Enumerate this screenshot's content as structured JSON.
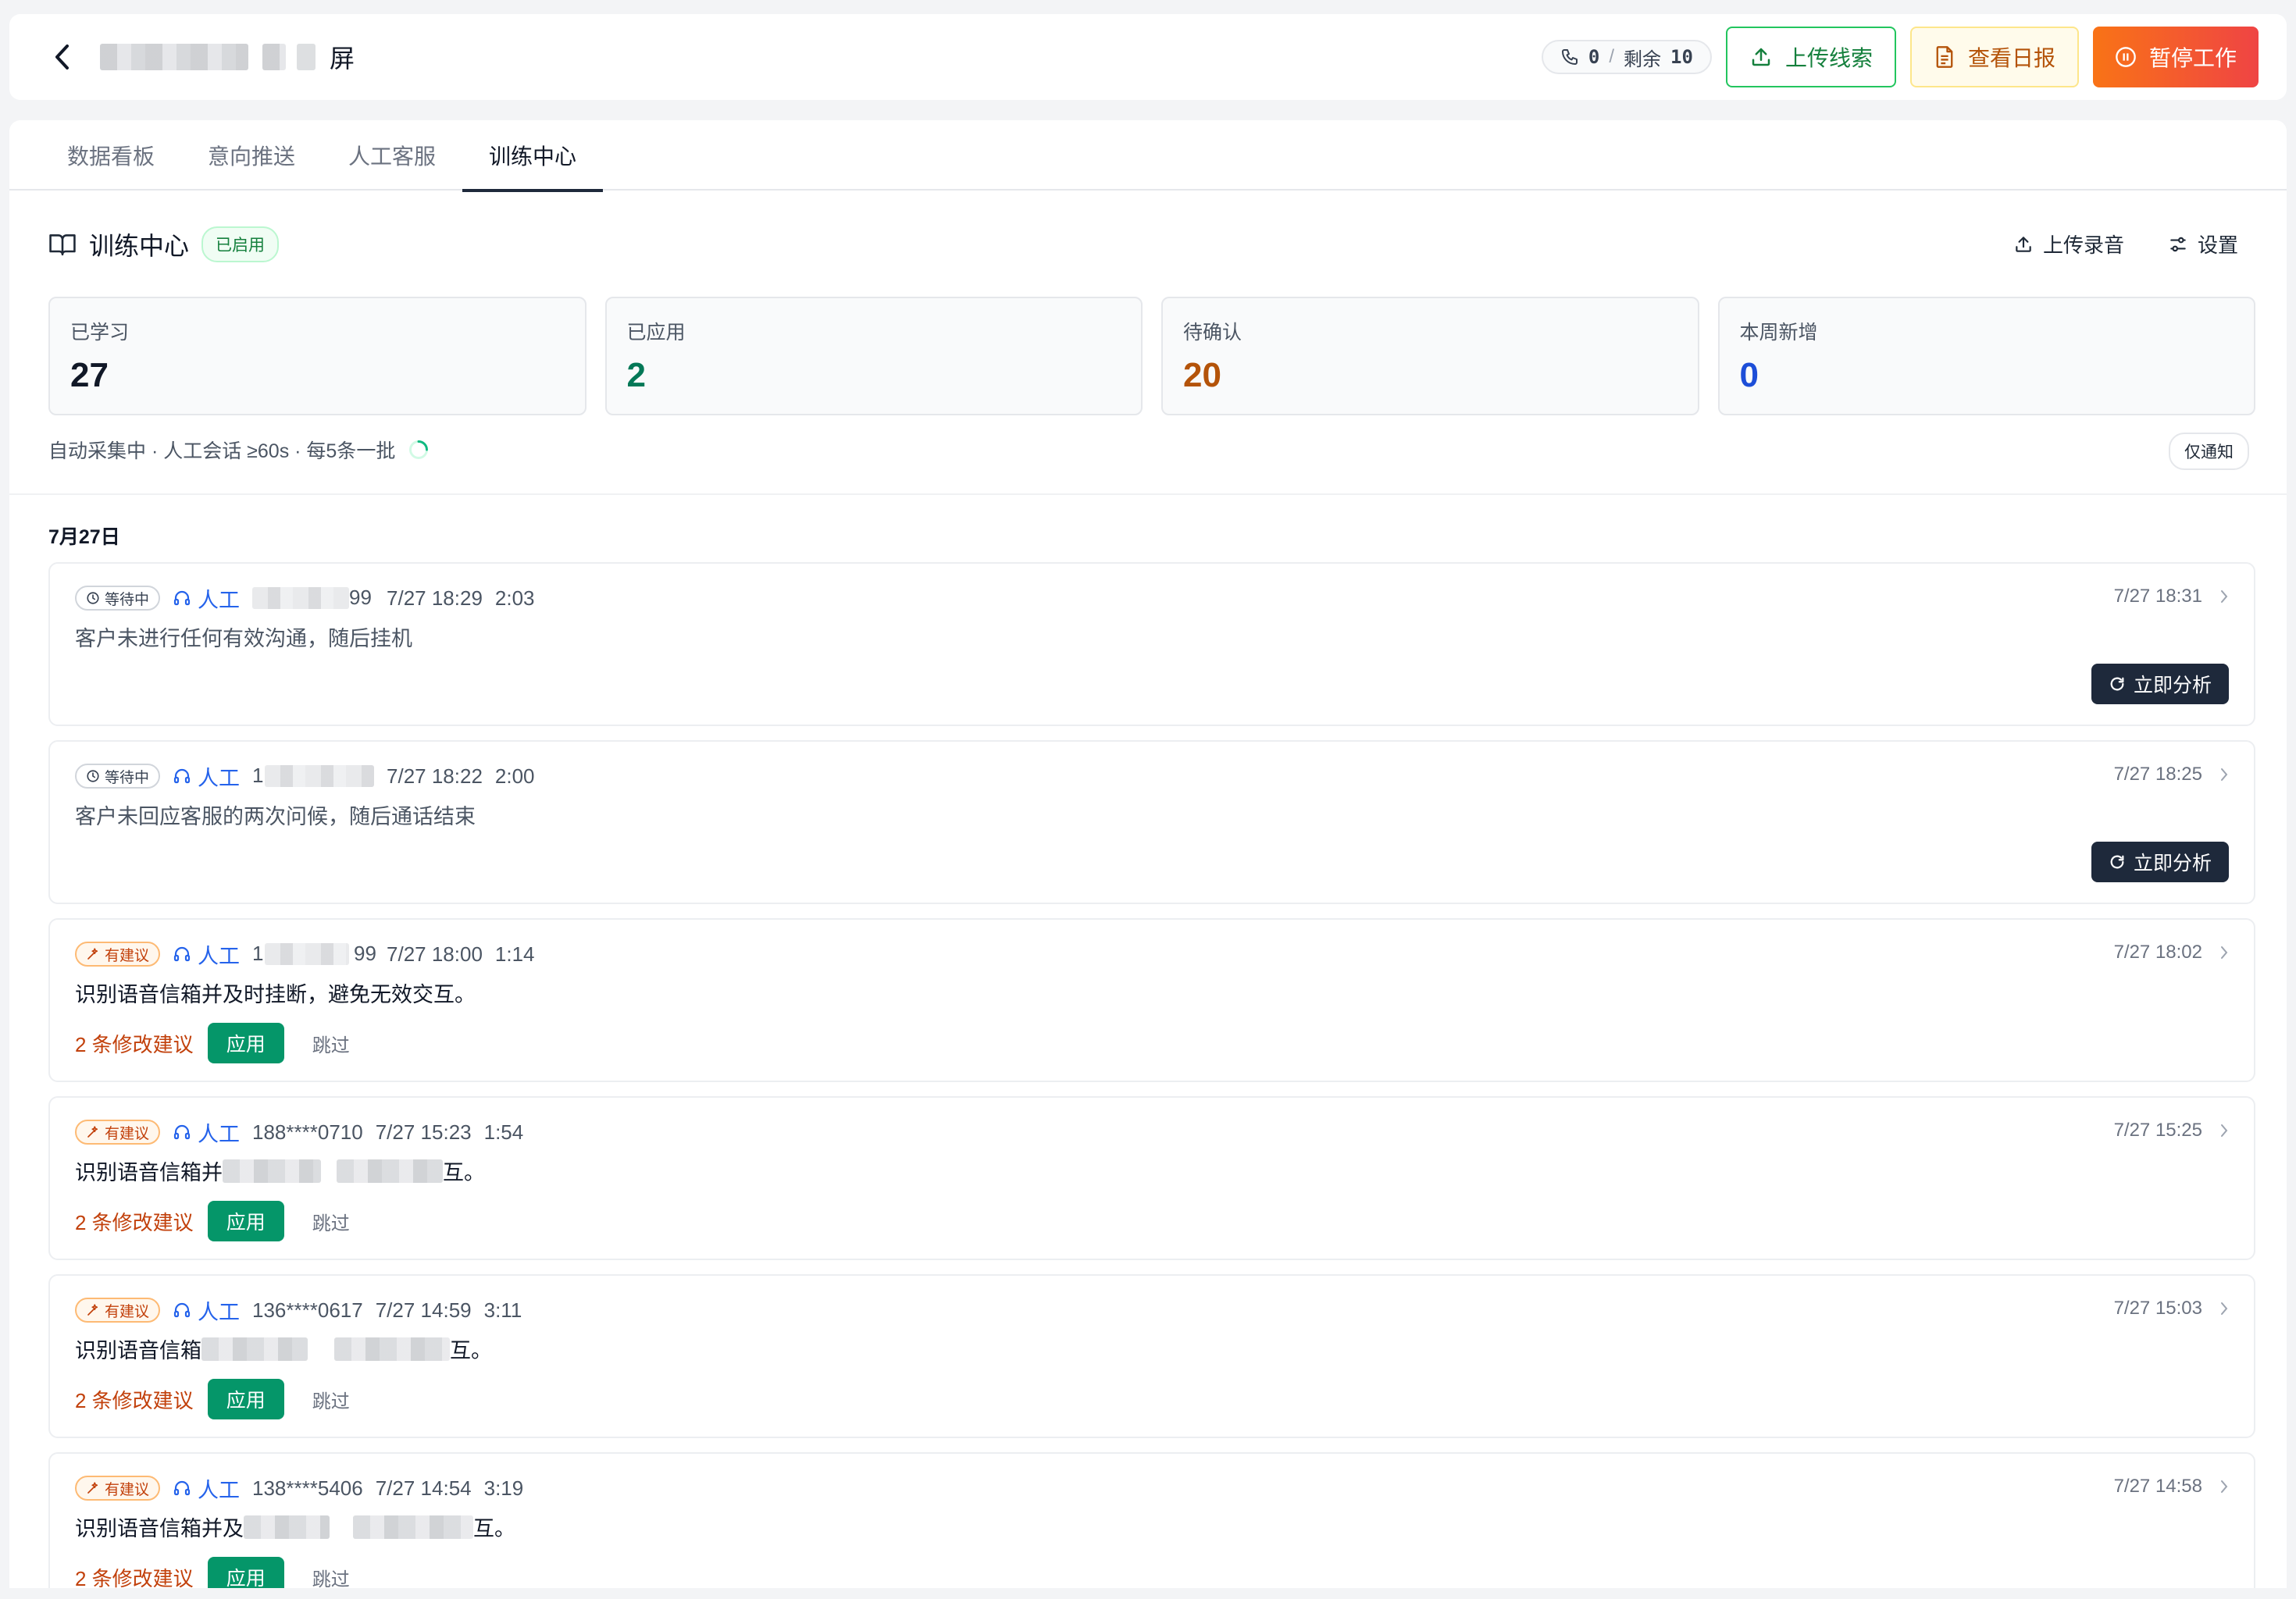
{
  "header": {
    "title_suffix": "屏",
    "calls": "0",
    "separator": "/",
    "remaining_label": "剩余",
    "remaining_count": "10",
    "upload_leads_label": "上传线索",
    "daily_report_label": "查看日报",
    "pause_label": "暂停工作"
  },
  "tabs": [
    {
      "label": "数据看板"
    },
    {
      "label": "意向推送"
    },
    {
      "label": "人工客服"
    },
    {
      "label": "训练中心"
    }
  ],
  "training": {
    "title": "训练中心",
    "status_badge": "已启用",
    "upload_recording_label": "上传录音",
    "settings_label": "设置",
    "stats": [
      {
        "label": "已学习",
        "value": "27",
        "color": "#111827"
      },
      {
        "label": "已应用",
        "value": "2",
        "color": "#047857"
      },
      {
        "label": "待确认",
        "value": "20",
        "color": "#b45309"
      },
      {
        "label": "本周新增",
        "value": "0",
        "color": "#1d4ed8"
      }
    ],
    "collect_status": "自动采集中 · 人工会话 ≥60s · 每5条一批",
    "notify_mode": "仅通知",
    "date_group": "7月27日"
  },
  "records": [
    {
      "status": "等待中",
      "source": "人工",
      "phone": "99",
      "call_time": "7/27 18:29",
      "duration": "2:03",
      "created": "7/27 18:31",
      "summary": "客户未进行任何有效沟通，随后挂机",
      "action": "立即分析"
    },
    {
      "status": "等待中",
      "source": "人工",
      "phone": "1",
      "call_time": "7/27 18:22",
      "duration": "2:00",
      "created": "7/27 18:25",
      "summary": "客户未回应客服的两次问候，随后通话结束",
      "action": "立即分析"
    },
    {
      "status": "有建议",
      "source": "人工",
      "phone": "1                99",
      "call_time": "7/27 18:00",
      "duration": "1:14",
      "created": "7/27 18:02",
      "summary": "识别语音信箱并及时挂断，避免无效交互。",
      "suggestions": "2 条修改建议",
      "apply": "应用",
      "skip": "跳过"
    },
    {
      "status": "有建议",
      "source": "人工",
      "phone": "188****0710",
      "call_time": "7/27 15:23",
      "duration": "1:54",
      "created": "7/27 15:25",
      "summary": "识别语音信箱并",
      "summary_tail": "互。",
      "suggestions": "2 条修改建议",
      "apply": "应用",
      "skip": "跳过"
    },
    {
      "status": "有建议",
      "source": "人工",
      "phone": "136****0617",
      "call_time": "7/27 14:59",
      "duration": "3:11",
      "created": "7/27 15:03",
      "summary": "识别语音信箱",
      "summary_tail": "互。",
      "suggestions": "2 条修改建议",
      "apply": "应用",
      "skip": "跳过"
    },
    {
      "status": "有建议",
      "source": "人工",
      "phone": "138****5406",
      "call_time": "7/27 14:54",
      "duration": "3:19",
      "created": "7/27 14:58",
      "summary": "识别语音信箱并及",
      "summary_tail": "互。",
      "suggestions": "2 条修改建议",
      "apply": "应用",
      "skip": "跳过"
    }
  ]
}
